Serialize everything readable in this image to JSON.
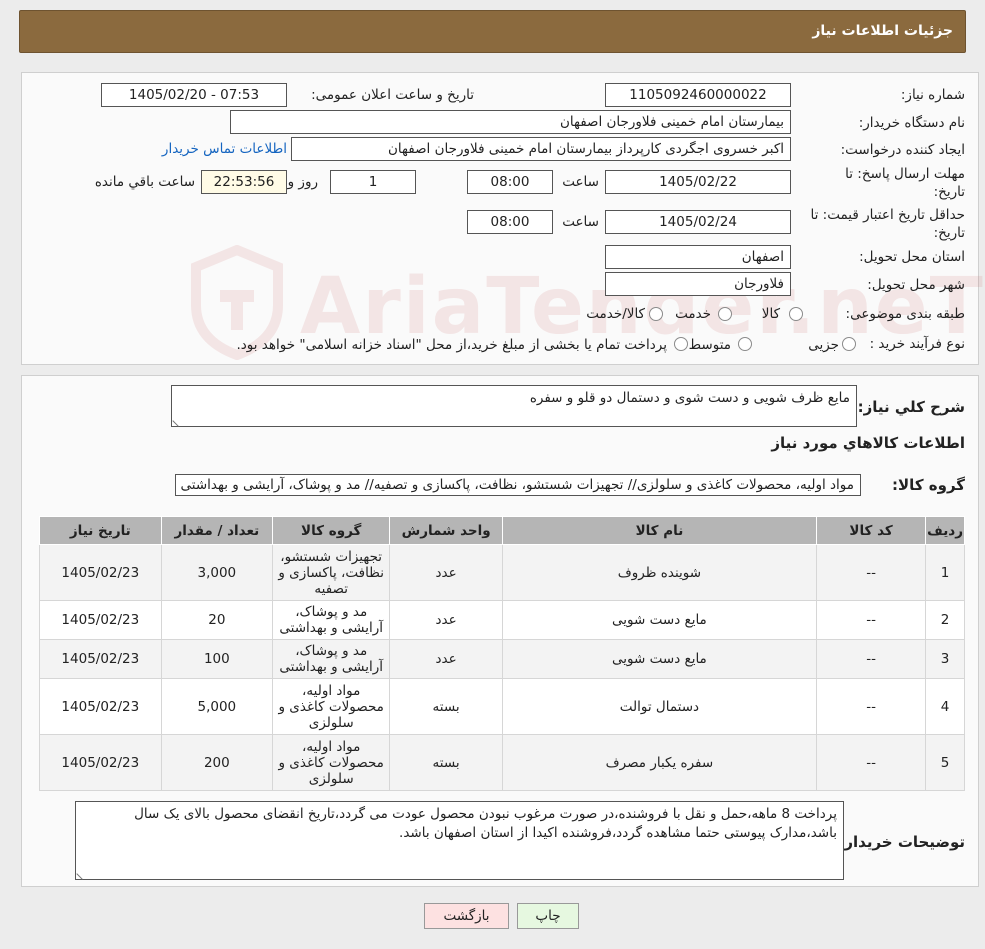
{
  "header": {
    "title": "جزئیات اطلاعات نیاز"
  },
  "form": {
    "need_number_label": "شماره نیاز:",
    "need_number": "1105092460000022",
    "announce_label": "تاریخ و ساعت اعلان عمومی:",
    "announce_value": "1405/02/20 - 07:53",
    "buyer_org_label": "نام دستگاه خریدار:",
    "buyer_org": "بیمارستان امام خمینی فلاورجان اصفهان",
    "creator_label": "ایجاد کننده درخواست:",
    "creator": "اکبر خسروی اجگردی کارپرداز بیمارستان امام خمینی فلاورجان اصفهان",
    "contact_link": "اطلاعات تماس خریدار",
    "deadline_label_1": "مهلت ارسال پاسخ: تا",
    "deadline_label_2": "تاریخ:",
    "deadline_date": "1405/02/22",
    "time_label": "ساعت",
    "deadline_time": "08:00",
    "days_value": "1",
    "days_label": "روز و",
    "remaining_time": "22:53:56",
    "remaining_label": "ساعت باقي مانده",
    "validity_label_1": "حداقل تاریخ اعتبار قیمت: تا",
    "validity_label_2": "تاریخ:",
    "validity_date": "1405/02/24",
    "validity_time": "08:00",
    "province_label": "استان محل تحویل:",
    "province": "اصفهان",
    "city_label": "شهر محل تحویل:",
    "city": "فلاورجان",
    "category_label": "طبقه بندی موضوعی:",
    "category_options": [
      "کالا",
      "خدمت",
      "کالا/خدمت"
    ],
    "process_label": "نوع فرآیند خرید :",
    "process_options": [
      "جزیی",
      "متوسط"
    ],
    "process_note": "پرداخت تمام یا بخشی از مبلغ خرید،از محل \"اسناد خزانه اسلامی\" خواهد بود."
  },
  "watermark": {
    "text": "AriaTender.neT"
  },
  "details": {
    "summary_label": "شرح کلي نياز:",
    "summary": "مایع ظرف شویی و دست شوی و دستمال دو قلو و سفره",
    "items_title": "اطلاعات کالاهاي مورد نياز",
    "group_label": "گروه کالا:",
    "group_value": "مواد اولیه، محصولات کاغذی و سلولزی// تجهیزات شستشو، نظافت، پاکسازی و تصفیه// مد و پوشاک، آرایشی و بهداشتی",
    "table": {
      "headers": [
        "ردیف",
        "کد کالا",
        "نام کالا",
        "واحد شمارش",
        "گروه کالا",
        "تعداد / مقدار",
        "تاریخ نیاز"
      ],
      "rows": [
        [
          "1",
          "--",
          "شوینده ظروف",
          "عدد",
          "تجهیزات شستشو، نظافت، پاکسازی و تصفیه",
          "3,000",
          "1405/02/23"
        ],
        [
          "2",
          "--",
          "مایع دست شویی",
          "عدد",
          "مد و پوشاک، آرایشی و بهداشتی",
          "20",
          "1405/02/23"
        ],
        [
          "3",
          "--",
          "مایع دست شویی",
          "عدد",
          "مد و پوشاک، آرایشی و بهداشتی",
          "100",
          "1405/02/23"
        ],
        [
          "4",
          "--",
          "دستمال توالت",
          "بسته",
          "مواد اولیه، محصولات کاغذی و سلولزی",
          "5,000",
          "1405/02/23"
        ],
        [
          "5",
          "--",
          "سفره یکبار مصرف",
          "بسته",
          "مواد اولیه، محصولات کاغذی و سلولزی",
          "200",
          "1405/02/23"
        ]
      ]
    },
    "buyer_notes_label": "توضیحات خریدار:",
    "buyer_notes": "پرداخت 8 ماهه،حمل و نقل با فروشنده،در صورت مرغوب نبودن محصول عودت می گردد،تاریخ انقضای محصول بالای یک سال باشد،مدارک پیوستی حتما مشاهده گردد،فروشنده اکیدا از استان اصفهان باشد."
  },
  "buttons": {
    "print": "چاپ",
    "back": "بازگشت"
  },
  "colors": {
    "header_bg": "#8b6a3e",
    "link": "#1565c0",
    "back_btn": "#fde1e1",
    "print_btn": "#e6f8e0"
  }
}
